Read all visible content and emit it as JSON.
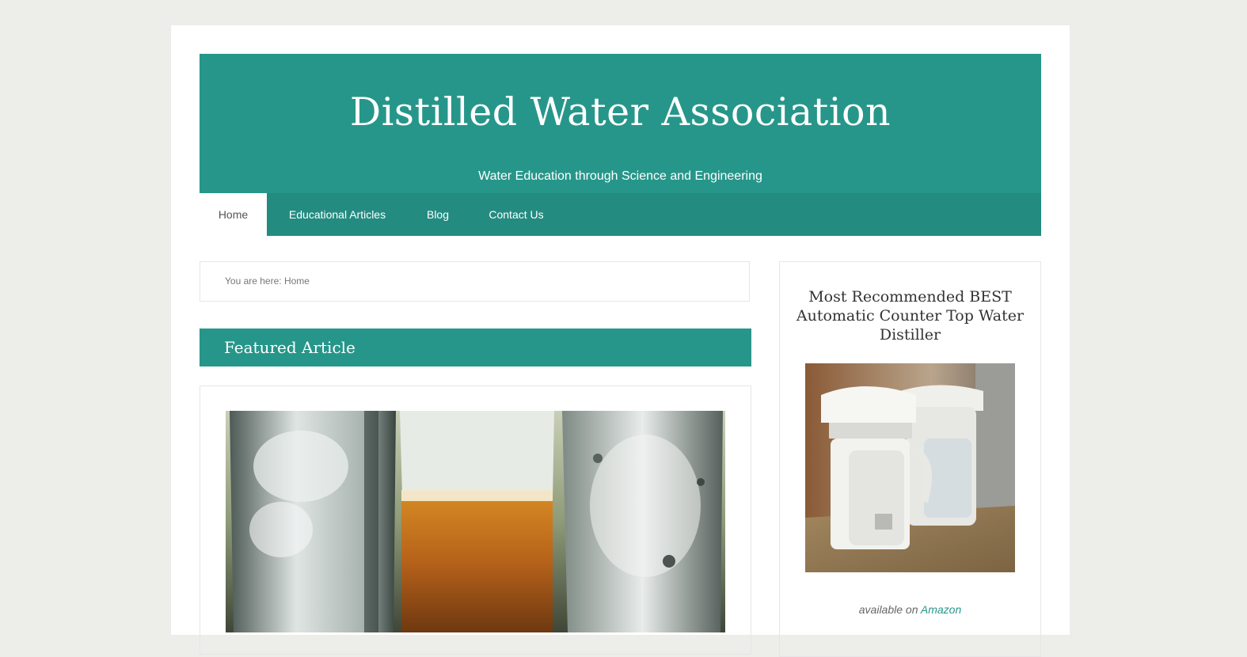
{
  "site": {
    "title": "Distilled Water Association",
    "description": "Water Education through Science and Engineering"
  },
  "nav": {
    "items": [
      {
        "label": "Home",
        "active": true
      },
      {
        "label": "Educational Articles",
        "active": false
      },
      {
        "label": "Blog",
        "active": false
      },
      {
        "label": "Contact Us",
        "active": false
      }
    ]
  },
  "breadcrumb": {
    "prefix": "You are here:",
    "current": "Home"
  },
  "featured": {
    "heading": "Featured Article"
  },
  "sidebar": {
    "widget_title": "Most Recommended BEST Automatic Counter Top Water Distiller",
    "availability_prefix": "available on",
    "availability_link": "Amazon"
  },
  "colors": {
    "accent": "#27968a",
    "nav": "#248b80",
    "background": "#ededea"
  }
}
